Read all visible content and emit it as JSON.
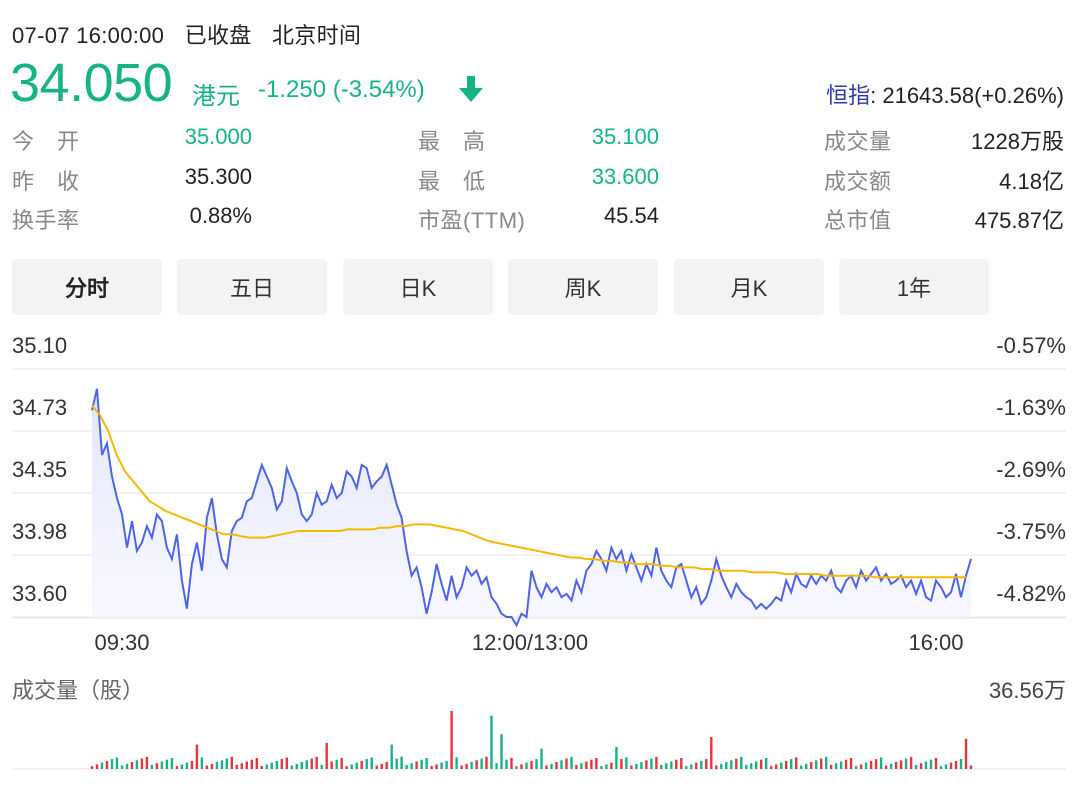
{
  "header": {
    "date_time": "07-07 16:00:00",
    "status": "已收盘",
    "timezone": "北京时间"
  },
  "quote": {
    "price": "34.050",
    "currency": "港元",
    "change": "-1.250 (-3.54%)",
    "direction_icon": "arrow-down-icon"
  },
  "index": {
    "label": "恒指",
    "value": ": 21643.58(+0.26%)"
  },
  "stats": {
    "open_label": "今　开",
    "open": "35.000",
    "prev_close_label": "昨　收",
    "prev_close": "35.300",
    "turnover_rate_label": "换手率",
    "turnover_rate": "0.88%",
    "high_label": "最　高",
    "high": "35.100",
    "low_label": "最　低",
    "low": "33.600",
    "pe_label": "市盈(TTM)",
    "pe": "45.54",
    "volume_label": "成交量",
    "volume": "1228万股",
    "amount_label": "成交额",
    "amount": "4.18亿",
    "market_cap_label": "总市值",
    "market_cap": "475.87亿"
  },
  "tabs": [
    "分时",
    "五日",
    "日K",
    "周K",
    "月K",
    "1年"
  ],
  "colors": {
    "up": "#e8343b",
    "down": "#17b384",
    "price_line": "#4f63e8",
    "avg_line": "#f5b800",
    "index_label": "#2f3aa5"
  },
  "chart_data": {
    "type": "line",
    "title": "",
    "y_ticks": [
      "35.10",
      "34.73",
      "34.35",
      "33.98",
      "33.60"
    ],
    "y_right_ticks": [
      "-0.57%",
      "-1.63%",
      "-2.69%",
      "-3.75%",
      "-4.82%"
    ],
    "x_ticks": [
      "09:30",
      "12:00/13:00",
      "16:00"
    ],
    "ylim": [
      33.48,
      35.1
    ],
    "series": [
      {
        "role": "price",
        "values": [
          34.85,
          34.98,
          34.58,
          34.65,
          34.45,
          34.32,
          34.22,
          34.02,
          34.18,
          34.0,
          34.05,
          34.15,
          34.08,
          34.22,
          34.18,
          34.02,
          33.95,
          34.1,
          33.82,
          33.65,
          33.92,
          34.05,
          33.88,
          34.2,
          34.32,
          34.1,
          33.95,
          33.9,
          34.12,
          34.18,
          34.2,
          34.3,
          34.32,
          34.42,
          34.52,
          34.45,
          34.38,
          34.25,
          34.3,
          34.5,
          34.42,
          34.35,
          34.22,
          34.18,
          34.22,
          34.35,
          34.28,
          34.3,
          34.4,
          34.32,
          34.35,
          34.48,
          34.45,
          34.38,
          34.52,
          34.5,
          34.38,
          34.42,
          34.45,
          34.52,
          34.4,
          34.28,
          34.2,
          34.0,
          33.85,
          33.9,
          33.78,
          33.62,
          33.75,
          33.92,
          33.8,
          33.7,
          33.85,
          33.72,
          33.78,
          33.9,
          33.85,
          33.88,
          33.8,
          33.84,
          33.72,
          33.68,
          33.62,
          33.6,
          33.6,
          33.55,
          33.62,
          33.6,
          33.88,
          33.78,
          33.72,
          33.8,
          33.75,
          33.78,
          33.72,
          33.74,
          33.7,
          33.82,
          33.75,
          33.88,
          33.92,
          34.0,
          33.95,
          33.88,
          34.02,
          33.95,
          34.0,
          33.88,
          33.98,
          33.9,
          33.82,
          33.92,
          33.85,
          34.02,
          33.88,
          33.82,
          33.78,
          33.9,
          33.92,
          33.82,
          33.72,
          33.78,
          33.68,
          33.72,
          33.82,
          33.95,
          33.85,
          33.78,
          33.72,
          33.8,
          33.75,
          33.72,
          33.7,
          33.65,
          33.68,
          33.65,
          33.68,
          33.72,
          33.7,
          33.82,
          33.75,
          33.86,
          33.8,
          33.78,
          33.85,
          33.8,
          33.85,
          33.82,
          33.88,
          33.78,
          33.75,
          33.82,
          33.85,
          33.78,
          33.88,
          33.82,
          33.86,
          33.9,
          33.82,
          33.86,
          33.8,
          33.82,
          33.85,
          33.78,
          33.82,
          33.74,
          33.82,
          33.72,
          33.7,
          33.82,
          33.78,
          33.72,
          33.75,
          33.86,
          33.72,
          33.85,
          33.95
        ],
        "count": 176
      },
      {
        "role": "average",
        "values": [
          34.88,
          34.82,
          34.72,
          34.58,
          34.48,
          34.42,
          34.36,
          34.3,
          34.27,
          34.24,
          34.22,
          34.2,
          34.18,
          34.16,
          34.14,
          34.12,
          34.1,
          34.1,
          34.09,
          34.08,
          34.08,
          34.08,
          34.09,
          34.1,
          34.11,
          34.12,
          34.12,
          34.12,
          34.12,
          34.12,
          34.12,
          34.13,
          34.13,
          34.13,
          34.13,
          34.14,
          34.14,
          34.15,
          34.15,
          34.16,
          34.16,
          34.16,
          34.15,
          34.14,
          34.13,
          34.12,
          34.1,
          34.08,
          34.06,
          34.05,
          34.04,
          34.03,
          34.02,
          34.01,
          34.0,
          33.99,
          33.98,
          33.97,
          33.96,
          33.96,
          33.95,
          33.95,
          33.94,
          33.94,
          33.93,
          33.93,
          33.92,
          33.92,
          33.92,
          33.91,
          33.91,
          33.9,
          33.9,
          33.9,
          33.89,
          33.89,
          33.88,
          33.88,
          33.88,
          33.88,
          33.87,
          33.87,
          33.87,
          33.87,
          33.86,
          33.86,
          33.86,
          33.86,
          33.86,
          33.85,
          33.85,
          33.85,
          33.85,
          33.85,
          33.85,
          33.84,
          33.84,
          33.84,
          33.84,
          33.84,
          33.84,
          33.84,
          33.84,
          33.84,
          33.84,
          33.84,
          33.84
        ],
        "count": 108
      }
    ],
    "volume": {
      "label": "成交量（股）",
      "max_label": "36.56万",
      "max": 365600
    }
  }
}
